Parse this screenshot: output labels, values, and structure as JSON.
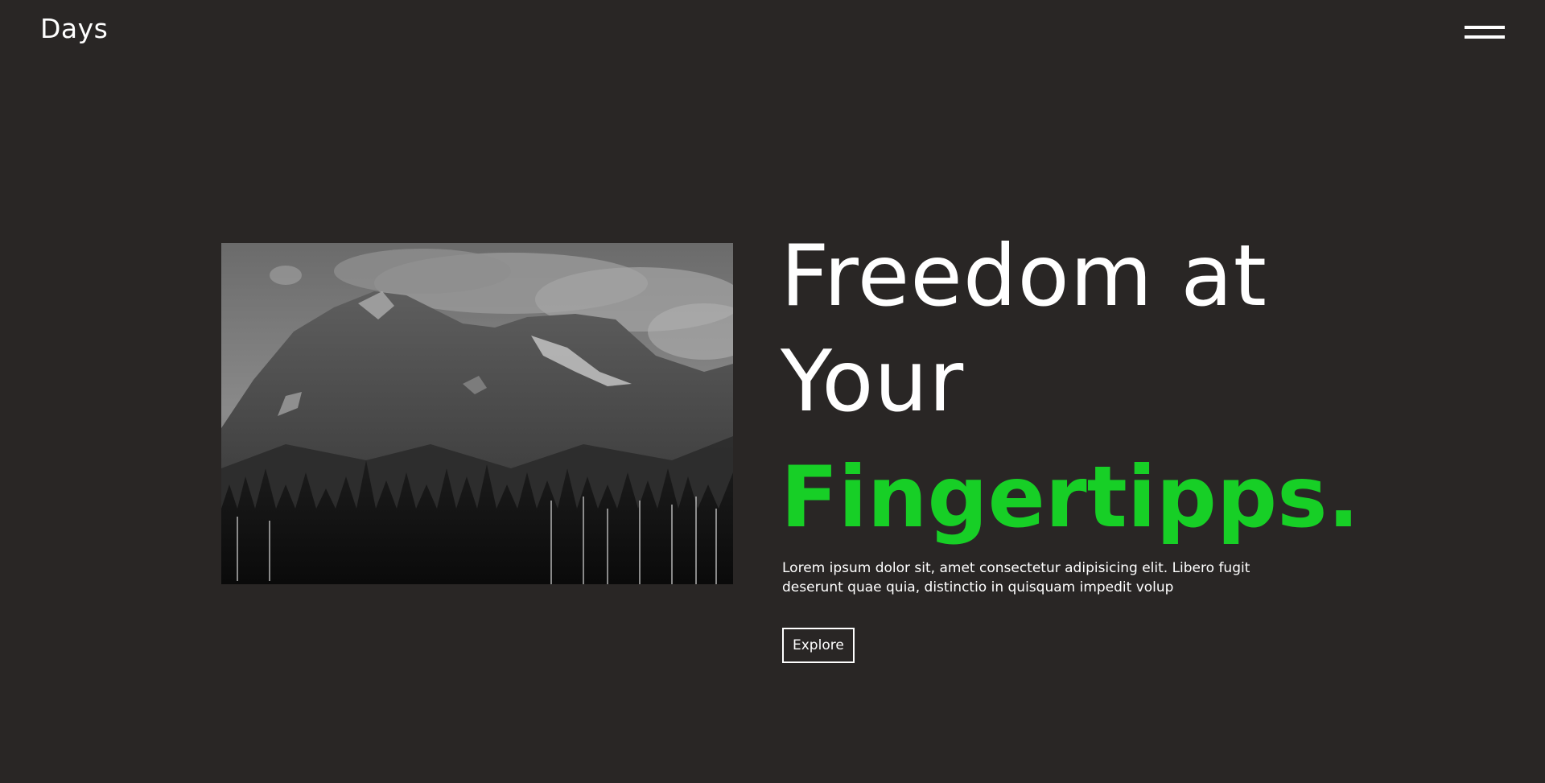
{
  "header": {
    "logo": "Days",
    "menu_icon": "hamburger-menu-icon"
  },
  "hero": {
    "image_icon": "mountain-forest-photo",
    "headline_line1": "Freedom at",
    "headline_line2": "Your",
    "headline_accent": "Fingertipps.",
    "description": "Lorem ipsum dolor sit, amet consectetur adipisicing elit. Libero fugit deserunt quae quia, distinctio in quisquam impedit volup",
    "explore_label": "Explore"
  },
  "colors": {
    "background": "#292625",
    "text": "#ffffff",
    "accent": "#17cf26"
  }
}
